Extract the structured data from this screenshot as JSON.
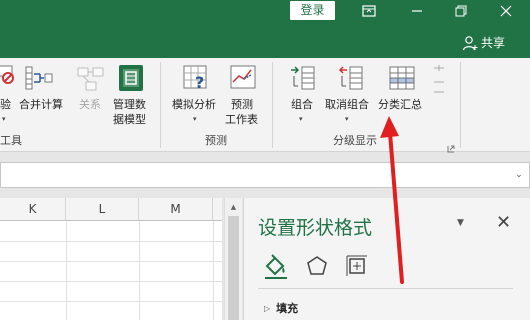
{
  "titlebar": {
    "signin_label": "登录",
    "ribbon_display_icon": "ribbon-display-options-icon",
    "minimize_icon": "minimize-icon",
    "restore_icon": "restore-icon",
    "close_icon": "close-icon"
  },
  "share": {
    "label": "共享",
    "icon": "person-icon"
  },
  "ribbon": {
    "data_tools": {
      "validation_label": "验",
      "consolidate_label": "合并计算",
      "relationships_label": "关系",
      "data_model_label_1": "管理数",
      "data_model_label_2": "据模型",
      "group_label": "工具"
    },
    "forecast": {
      "whatif_label": "模拟分析",
      "forecast_sheet_label_1": "预测",
      "forecast_sheet_label_2": "工作表",
      "group_label": "预测"
    },
    "outline": {
      "group_btn_label": "组合",
      "ungroup_label": "取消组合",
      "subtotal_label": "分类汇总",
      "group_label": "分级显示"
    }
  },
  "sheet": {
    "columns": [
      "K",
      "L",
      "M"
    ]
  },
  "format_pane": {
    "title": "设置形状格式",
    "tabs": [
      "fill-line-icon",
      "effects-icon",
      "size-properties-icon"
    ],
    "section_fill": "填充"
  },
  "colors": {
    "excel_green": "#217346",
    "annotation_red": "#e02020"
  }
}
